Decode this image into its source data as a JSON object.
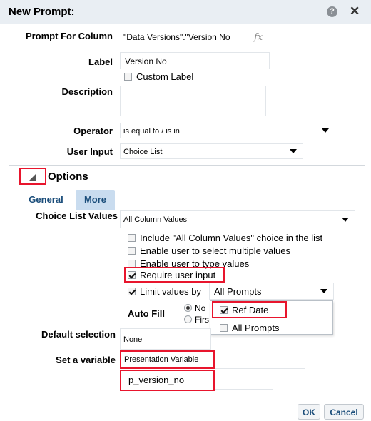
{
  "dialog": {
    "title": "New Prompt:"
  },
  "form": {
    "prompt_for_column_label": "Prompt For Column",
    "prompt_for_column_value": "\"Data Versions\".\"Version No",
    "fx": "fx",
    "label_label": "Label",
    "label_value": "Version No",
    "custom_label": "Custom Label",
    "description_label": "Description",
    "operator_label": "Operator",
    "operator_value": "is equal to / is in",
    "user_input_label": "User Input",
    "user_input_value": "Choice List"
  },
  "options": {
    "header": "Options",
    "tabs": [
      {
        "label": "General"
      },
      {
        "label": "More"
      }
    ],
    "choice_list_values_label": "Choice List Values",
    "choice_list_values_value": "All Column Values",
    "checks": [
      {
        "label": "Include \"All Column Values\" choice in the list",
        "checked": false
      },
      {
        "label": "Enable user to select multiple values",
        "checked": false
      },
      {
        "label": "Enable user to type values",
        "checked": false
      },
      {
        "label": "Require user input",
        "checked": true
      },
      {
        "label": "Limit values by",
        "checked": true
      }
    ],
    "limit_values_select": "All Prompts",
    "dropdown_items": [
      {
        "label": "Ref Date",
        "checked": true
      },
      {
        "label": "All Prompts",
        "checked": false
      }
    ],
    "auto_fill_label": "Auto Fill",
    "auto_fill_radio_no": "No",
    "auto_fill_radio_first": "Firs",
    "default_selection_label": "Default selection",
    "default_selection_value": "None",
    "set_variable_label": "Set a variable",
    "set_variable_type": "Presentation Variable",
    "set_variable_name": "p_version_no"
  },
  "buttons": {
    "ok": "OK",
    "cancel": "Cancel"
  }
}
